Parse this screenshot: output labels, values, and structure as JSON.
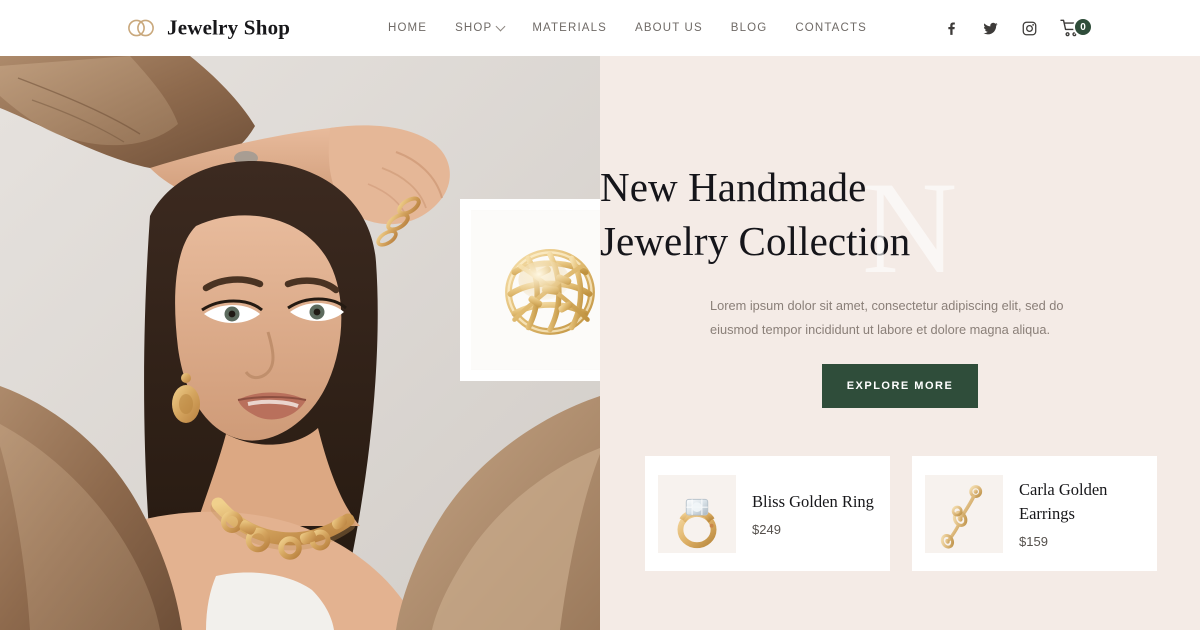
{
  "header": {
    "brand_name": "Jewelry Shop",
    "logo_icon": "interlocking-rings-icon",
    "nav": [
      {
        "label": "HOME",
        "has_dropdown": false
      },
      {
        "label": "SHOP",
        "has_dropdown": true
      },
      {
        "label": "MATERIALS",
        "has_dropdown": false
      },
      {
        "label": "ABOUT US",
        "has_dropdown": false
      },
      {
        "label": "BLOG",
        "has_dropdown": false
      },
      {
        "label": "CONTACTS",
        "has_dropdown": false
      }
    ],
    "social": [
      {
        "icon": "facebook-icon"
      },
      {
        "icon": "twitter-icon"
      },
      {
        "icon": "instagram-icon"
      }
    ],
    "cart": {
      "icon": "shopping-cart-icon",
      "count": "0",
      "badge_color": "#2f4d3a"
    }
  },
  "hero": {
    "watermark_letter": "N",
    "headline_line1": "New Handmade",
    "headline_line2": "Jewelry Collection",
    "subtext": "Lorem ipsum dolor sit amet, consectetur adipiscing elit, sed do eiusmod tempor incididunt ut labore et dolore magna aliqua.",
    "cta_label": "EXPLORE MORE",
    "cta_color": "#2f4d3a",
    "background_color": "#f4ebe6",
    "photo_alt": "model-wearing-gold-jewelry-photo",
    "inset_image_alt": "ornate-gold-ring-photo"
  },
  "products": [
    {
      "name": "Bliss Golden Ring",
      "price": "$249",
      "thumb_alt": "gold-diamond-ring-thumbnail"
    },
    {
      "name": "Carla Golden Earrings",
      "price": "$159",
      "thumb_alt": "gold-drop-earrings-thumbnail"
    }
  ]
}
